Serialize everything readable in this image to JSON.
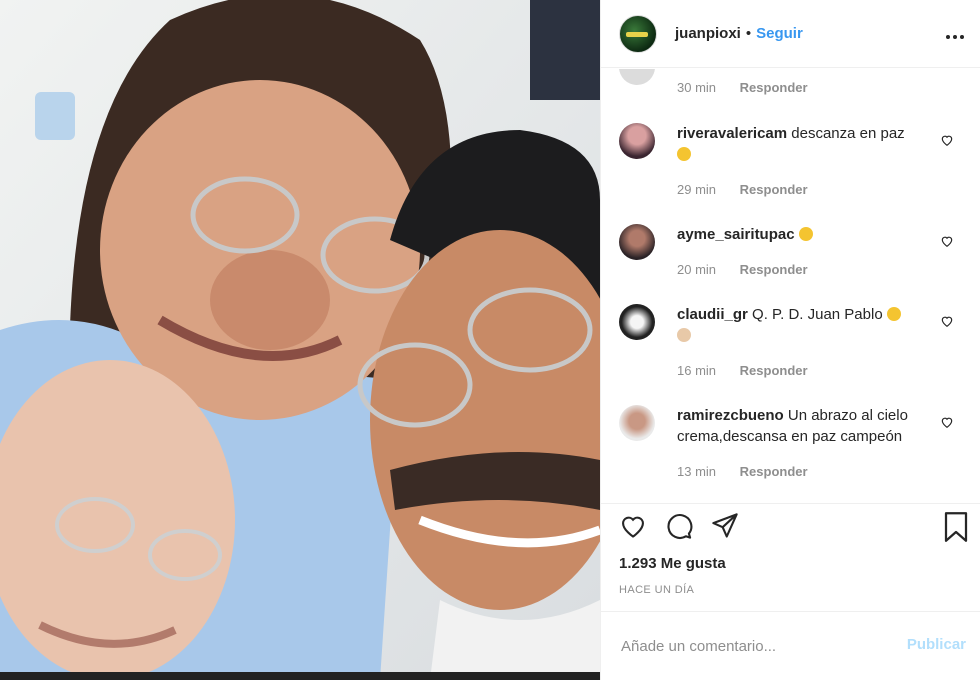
{
  "post_header": {
    "username": "juanpioxi",
    "separator": "•",
    "follow_label": "Seguir",
    "more_label": "•••"
  },
  "comments": [
    {
      "username": "",
      "text": "",
      "time": "30 min",
      "reply_label": "Responder"
    },
    {
      "username": "riveravalericam",
      "text": "descanza en paz",
      "emoji": "frowning-face",
      "time": "29 min",
      "reply_label": "Responder"
    },
    {
      "username": "ayme_sairitupac",
      "text": "",
      "emoji": "worried-face",
      "time": "20 min",
      "reply_label": "Responder"
    },
    {
      "username": "claudii_gr",
      "text": "Q. P. D. Juan Pablo",
      "emoji": "sad-face",
      "emoji2": "praying-person",
      "time": "16 min",
      "reply_label": "Responder"
    },
    {
      "username": "ramirezcbueno",
      "text": "Un abrazo al cielo crema,descansa en paz campeón",
      "time": "13 min",
      "reply_label": "Responder"
    }
  ],
  "actions": {
    "icons": [
      "heart-icon",
      "comment-icon",
      "share-icon",
      "bookmark-icon"
    ]
  },
  "likes_text": "1.293 Me gusta",
  "posted_ago": "HACE UN DÍA",
  "add_comment": {
    "placeholder": "Añade un comentario...",
    "publish_label": "Publicar"
  },
  "colors": {
    "link_blue": "#3897f0",
    "publish_disabled": "#b2dffc",
    "muted_text": "#8e8e8e",
    "border": "#efefef"
  }
}
